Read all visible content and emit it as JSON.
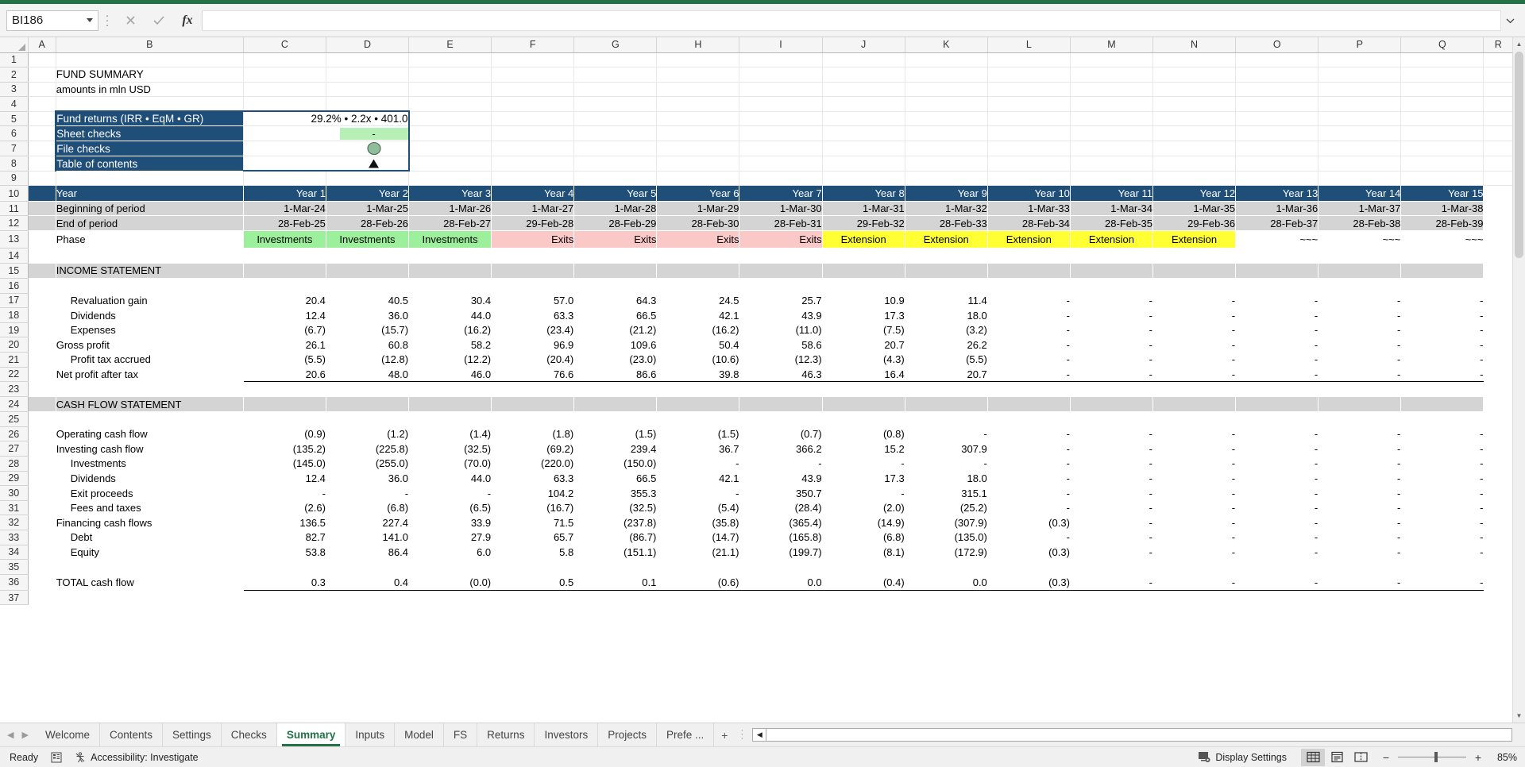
{
  "formula_bar": {
    "name_box_value": "BI186",
    "formula_value": "",
    "cancel_icon": "close-icon",
    "confirm_icon": "check-icon",
    "function_icon": "fx-icon"
  },
  "columns": [
    "A",
    "B",
    "C",
    "D",
    "E",
    "F",
    "G",
    "H",
    "I",
    "J",
    "K",
    "L",
    "M",
    "N",
    "O",
    "P",
    "Q",
    "R"
  ],
  "row_numbers": [
    "1",
    "2",
    "3",
    "4",
    "5",
    "6",
    "7",
    "8",
    "9",
    "10",
    "11",
    "12",
    "13",
    "14",
    "15",
    "16",
    "17",
    "18",
    "19",
    "20",
    "21",
    "22",
    "23",
    "24",
    "25",
    "26",
    "27",
    "28",
    "29",
    "30",
    "31",
    "32",
    "33",
    "34",
    "35",
    "36",
    "37"
  ],
  "sheet": {
    "title": "FUND SUMMARY",
    "subtitle": "amounts in mln USD",
    "summary_box": [
      {
        "label": "Fund returns (IRR • EqM • GR)",
        "value": "29.2% • 2.2x • 401.0",
        "type": "text"
      },
      {
        "label": "Sheet checks",
        "value": "-",
        "type": "check_ok"
      },
      {
        "label": "File checks",
        "value": "",
        "type": "circle"
      },
      {
        "label": "Table of contents",
        "value": "",
        "type": "triangle"
      }
    ],
    "year_header_label": "Year",
    "years": [
      "Year 1",
      "Year 2",
      "Year 3",
      "Year 4",
      "Year 5",
      "Year 6",
      "Year 7",
      "Year 8",
      "Year 9",
      "Year 10",
      "Year 11",
      "Year 12",
      "Year 13",
      "Year 14",
      "Year 15"
    ],
    "beginning_label": "Beginning of period",
    "beginning_of_period": [
      "1-Mar-24",
      "1-Mar-25",
      "1-Mar-26",
      "1-Mar-27",
      "1-Mar-28",
      "1-Mar-29",
      "1-Mar-30",
      "1-Mar-31",
      "1-Mar-32",
      "1-Mar-33",
      "1-Mar-34",
      "1-Mar-35",
      "1-Mar-36",
      "1-Mar-37",
      "1-Mar-38"
    ],
    "end_label": "End of period",
    "end_of_period": [
      "28-Feb-25",
      "28-Feb-26",
      "28-Feb-27",
      "29-Feb-28",
      "28-Feb-29",
      "28-Feb-30",
      "28-Feb-31",
      "29-Feb-32",
      "28-Feb-33",
      "28-Feb-34",
      "28-Feb-35",
      "29-Feb-36",
      "28-Feb-37",
      "28-Feb-38",
      "28-Feb-39"
    ],
    "phase_label": "Phase",
    "phases": [
      "Investments",
      "Investments",
      "Investments",
      "Exits",
      "Exits",
      "Exits",
      "Exits",
      "Extension",
      "Extension",
      "Extension",
      "Extension",
      "Extension",
      "~~~",
      "~~~",
      "~~~"
    ],
    "income_statement": {
      "heading": "INCOME STATEMENT",
      "rows": [
        {
          "label": "Revaluation gain",
          "indent": 1,
          "bold": false,
          "values": [
            "20.4",
            "40.5",
            "30.4",
            "57.0",
            "64.3",
            "24.5",
            "25.7",
            "10.9",
            "11.4",
            "-",
            "-",
            "-",
            "-",
            "-",
            "-"
          ]
        },
        {
          "label": "Dividends",
          "indent": 1,
          "bold": false,
          "values": [
            "12.4",
            "36.0",
            "44.0",
            "63.3",
            "66.5",
            "42.1",
            "43.9",
            "17.3",
            "18.0",
            "-",
            "-",
            "-",
            "-",
            "-",
            "-"
          ]
        },
        {
          "label": "Expenses",
          "indent": 1,
          "bold": false,
          "values": [
            "(6.7)",
            "(15.7)",
            "(16.2)",
            "(23.4)",
            "(21.2)",
            "(16.2)",
            "(11.0)",
            "(7.5)",
            "(3.2)",
            "-",
            "-",
            "-",
            "-",
            "-",
            "-"
          ]
        },
        {
          "label": "Gross profit",
          "indent": 0,
          "bold": true,
          "values": [
            "26.1",
            "60.8",
            "58.2",
            "96.9",
            "109.6",
            "50.4",
            "58.6",
            "20.7",
            "26.2",
            "-",
            "-",
            "-",
            "-",
            "-",
            "-"
          ]
        },
        {
          "label": "Profit tax accrued",
          "indent": 1,
          "bold": false,
          "values": [
            "(5.5)",
            "(12.8)",
            "(12.2)",
            "(20.4)",
            "(23.0)",
            "(10.6)",
            "(12.3)",
            "(4.3)",
            "(5.5)",
            "-",
            "-",
            "-",
            "-",
            "-",
            "-"
          ]
        },
        {
          "label": "Net profit after tax",
          "indent": 0,
          "bold": true,
          "values": [
            "20.6",
            "48.0",
            "46.0",
            "76.6",
            "86.6",
            "39.8",
            "46.3",
            "16.4",
            "20.7",
            "-",
            "-",
            "-",
            "-",
            "-",
            "-"
          ]
        }
      ]
    },
    "cash_flow_statement": {
      "heading": "CASH FLOW STATEMENT",
      "rows": [
        {
          "label": "Operating cash flow",
          "indent": 0,
          "bold": true,
          "values": [
            "(0.9)",
            "(1.2)",
            "(1.4)",
            "(1.8)",
            "(1.5)",
            "(1.5)",
            "(0.7)",
            "(0.8)",
            "-",
            "-",
            "-",
            "-",
            "-",
            "-",
            "-"
          ]
        },
        {
          "label": "Investing cash flow",
          "indent": 0,
          "bold": true,
          "values": [
            "(135.2)",
            "(225.8)",
            "(32.5)",
            "(69.2)",
            "239.4",
            "36.7",
            "366.2",
            "15.2",
            "307.9",
            "-",
            "-",
            "-",
            "-",
            "-",
            "-"
          ]
        },
        {
          "label": "Investments",
          "indent": 1,
          "bold": false,
          "values": [
            "(145.0)",
            "(255.0)",
            "(70.0)",
            "(220.0)",
            "(150.0)",
            "-",
            "-",
            "-",
            "-",
            "-",
            "-",
            "-",
            "-",
            "-",
            "-"
          ]
        },
        {
          "label": "Dividends",
          "indent": 1,
          "bold": false,
          "values": [
            "12.4",
            "36.0",
            "44.0",
            "63.3",
            "66.5",
            "42.1",
            "43.9",
            "17.3",
            "18.0",
            "-",
            "-",
            "-",
            "-",
            "-",
            "-"
          ]
        },
        {
          "label": "Exit proceeds",
          "indent": 1,
          "bold": false,
          "values": [
            "-",
            "-",
            "-",
            "104.2",
            "355.3",
            "-",
            "350.7",
            "-",
            "315.1",
            "-",
            "-",
            "-",
            "-",
            "-",
            "-"
          ]
        },
        {
          "label": "Fees and taxes",
          "indent": 1,
          "bold": false,
          "values": [
            "(2.6)",
            "(6.8)",
            "(6.5)",
            "(16.7)",
            "(32.5)",
            "(5.4)",
            "(28.4)",
            "(2.0)",
            "(25.2)",
            "-",
            "-",
            "-",
            "-",
            "-",
            "-"
          ]
        },
        {
          "label": "Financing cash flows",
          "indent": 0,
          "bold": true,
          "values": [
            "136.5",
            "227.4",
            "33.9",
            "71.5",
            "(237.8)",
            "(35.8)",
            "(365.4)",
            "(14.9)",
            "(307.9)",
            "(0.3)",
            "-",
            "-",
            "-",
            "-",
            "-"
          ]
        },
        {
          "label": "Debt",
          "indent": 1,
          "bold": false,
          "values": [
            "82.7",
            "141.0",
            "27.9",
            "65.7",
            "(86.7)",
            "(14.7)",
            "(165.8)",
            "(6.8)",
            "(135.0)",
            "-",
            "-",
            "-",
            "-",
            "-",
            "-"
          ]
        },
        {
          "label": "Equity",
          "indent": 1,
          "bold": false,
          "values": [
            "53.8",
            "86.4",
            "6.0",
            "5.8",
            "(151.1)",
            "(21.1)",
            "(199.7)",
            "(8.1)",
            "(172.9)",
            "(0.3)",
            "-",
            "-",
            "-",
            "-",
            "-"
          ]
        }
      ],
      "total_row": {
        "label": "TOTAL cash flow",
        "values": [
          "0.3",
          "0.4",
          "(0.0)",
          "0.5",
          "0.1",
          "(0.6)",
          "0.0",
          "(0.4)",
          "0.0",
          "(0.3)",
          "-",
          "-",
          "-",
          "-",
          "-"
        ]
      }
    }
  },
  "tabs": {
    "items": [
      {
        "label": "Welcome",
        "active": false
      },
      {
        "label": "Contents",
        "active": false
      },
      {
        "label": "Settings",
        "active": false
      },
      {
        "label": "Checks",
        "active": false
      },
      {
        "label": "Summary",
        "active": true
      },
      {
        "label": "Inputs",
        "active": false
      },
      {
        "label": "Model",
        "active": false
      },
      {
        "label": "FS",
        "active": false
      },
      {
        "label": "Returns",
        "active": false
      },
      {
        "label": "Investors",
        "active": false
      },
      {
        "label": "Projects",
        "active": false
      },
      {
        "label": "Prefe ...",
        "active": false
      }
    ],
    "add_sheet_label": "+"
  },
  "status_bar": {
    "ready_label": "Ready",
    "accessibility_label": "Accessibility: Investigate",
    "display_settings_label": "Display Settings",
    "zoom_label": "85%",
    "zoom_minus": "−",
    "zoom_plus": "+"
  },
  "colors": {
    "excel_green": "#217346",
    "header_navy": "#1f4e79",
    "phase_investments": "#9cf09c",
    "phase_exits": "#fbc8c8",
    "phase_extension": "#ffff33",
    "section_grey": "#d4d4d4"
  }
}
